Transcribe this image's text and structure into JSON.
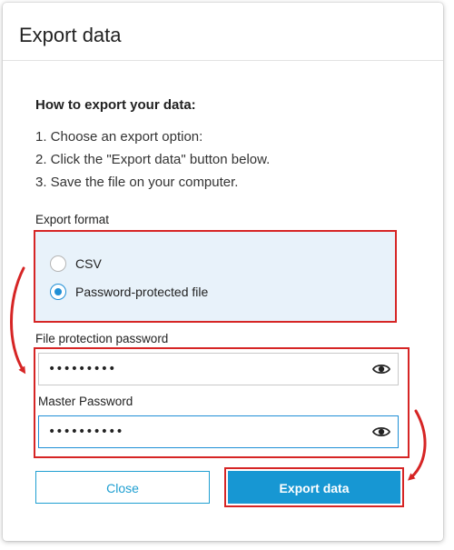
{
  "dialog": {
    "title": "Export data"
  },
  "instructions": {
    "heading": "How to export your data:",
    "steps": [
      "1. Choose an export option:",
      "2. Click the \"Export data\" button below.",
      "3. Save the file on your computer."
    ]
  },
  "export_format": {
    "label": "Export format",
    "options": [
      {
        "label": "CSV",
        "selected": false
      },
      {
        "label": "Password-protected file",
        "selected": true
      }
    ]
  },
  "file_password": {
    "label": "File protection password",
    "value": "•••••••••"
  },
  "master_password": {
    "label": "Master Password",
    "value": "••••••••••"
  },
  "buttons": {
    "close_label": "Close",
    "export_label": "Export data"
  },
  "icons": {
    "show_password": "eye-icon",
    "radio": "radio-icon"
  },
  "colors": {
    "accent": "#1797d3",
    "highlight": "#d62525",
    "selection_bg": "#e8f2fa"
  }
}
